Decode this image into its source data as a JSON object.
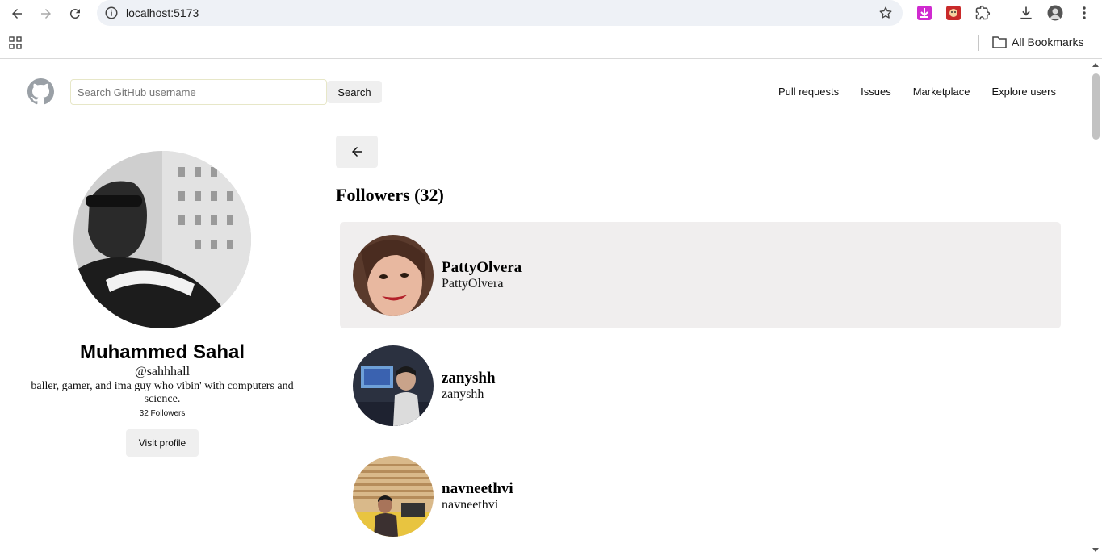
{
  "browser": {
    "url": "localhost:5173",
    "bookmarks_label": "All Bookmarks"
  },
  "header": {
    "search_placeholder": "Search GitHub username",
    "search_button": "Search",
    "nav": [
      "Pull requests",
      "Issues",
      "Marketplace",
      "Explore users"
    ]
  },
  "profile": {
    "name": "Muhammed Sahal",
    "handle": "@sahhhall",
    "bio": "baller, gamer, and ima guy who vibin' with computers and science.",
    "followers": "32 Followers",
    "visit_button": "Visit profile"
  },
  "followers_section": {
    "title": "Followers (32)",
    "items": [
      {
        "name": "PattyOlvera",
        "login": "PattyOlvera"
      },
      {
        "name": "zanyshh",
        "login": "zanyshh"
      },
      {
        "name": "navneethvi",
        "login": "navneethvi"
      }
    ]
  },
  "colors": {
    "active_row": "#f0eeee",
    "button_bg": "#efefef"
  }
}
